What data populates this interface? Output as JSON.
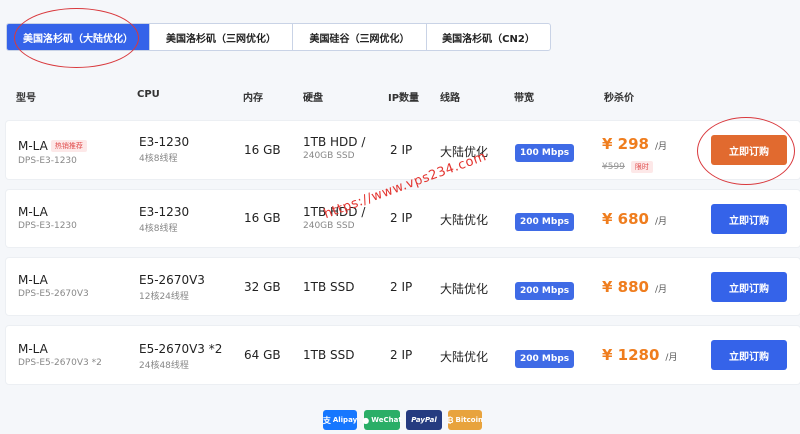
{
  "tabs": [
    {
      "label": "美国洛杉矶（大陆优化）"
    },
    {
      "label": "美国洛杉矶（三网优化）"
    },
    {
      "label": "美国硅谷（三网优化）"
    },
    {
      "label": "美国洛杉矶（CN2）"
    }
  ],
  "columns": {
    "model": "型号",
    "cpu": "CPU",
    "ram": "内存",
    "disk": "硬盘",
    "ip": "IP数量",
    "route": "线路",
    "bandwidth": "带宽",
    "price": "秒杀价"
  },
  "rows": [
    {
      "name": "M-LA",
      "hot": "热销推荐",
      "sku": "DPS-E3-1230",
      "cpu": "E3-1230",
      "cores": "4核8线程",
      "ram": "16 GB",
      "disk": "1TB HDD /",
      "disk2": "240GB SSD",
      "ip": "2 IP",
      "route": "大陆优化",
      "bandwidth": "100 Mbps",
      "price": "¥ 298",
      "unit": "/月",
      "orig": "¥599",
      "limit": "限时",
      "button": "立即订购"
    },
    {
      "name": "M-LA",
      "sku": "DPS-E3-1230",
      "cpu": "E3-1230",
      "cores": "4核8线程",
      "ram": "16 GB",
      "disk": "1TB HDD /",
      "disk2": "240GB SSD",
      "ip": "2 IP",
      "route": "大陆优化",
      "bandwidth": "200 Mbps",
      "price": "¥ 680",
      "unit": "/月",
      "button": "立即订购"
    },
    {
      "name": "M-LA",
      "sku": "DPS-E5-2670V3",
      "cpu": "E5-2670V3",
      "cores": "12核24线程",
      "ram": "32 GB",
      "disk": "1TB SSD",
      "ip": "2 IP",
      "route": "大陆优化",
      "bandwidth": "200 Mbps",
      "price": "¥ 880",
      "unit": "/月",
      "button": "立即订购"
    },
    {
      "name": "M-LA",
      "sku": "DPS-E5-2670V3 *2",
      "cpu": "E5-2670V3 *2",
      "cores": "24核48线程",
      "ram": "64 GB",
      "disk": "1TB SSD",
      "ip": "2 IP",
      "route": "大陆优化",
      "bandwidth": "200 Mbps",
      "price": "¥ 1280",
      "unit": "/月",
      "button": "立即订购"
    }
  ],
  "watermark": "https://www.vps234.com",
  "payments": [
    {
      "label": "Alipay",
      "color": "#1677ff"
    },
    {
      "label": "WeChat",
      "color": "#2aae67"
    },
    {
      "label": "PayPal",
      "color": "#253b80"
    },
    {
      "label": "Bitcoin",
      "color": "#e8a33d"
    }
  ]
}
